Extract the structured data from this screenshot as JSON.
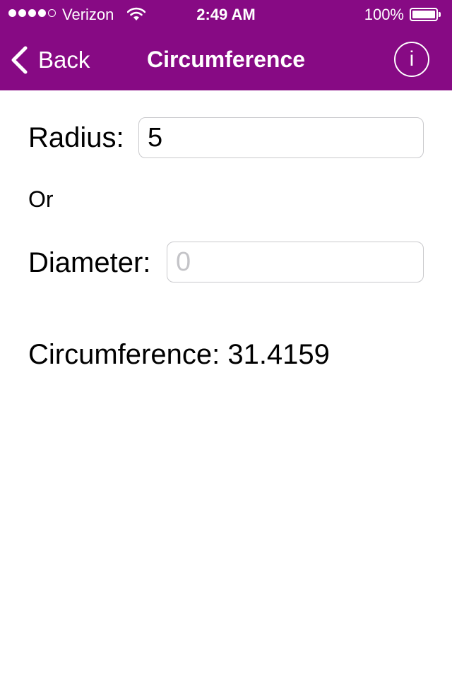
{
  "status_bar": {
    "carrier": "Verizon",
    "time": "2:49 AM",
    "battery_percent": "100%",
    "battery_level": 1.0,
    "signal_bars_filled": 4,
    "signal_bars_total": 5
  },
  "nav": {
    "back_label": "Back",
    "title": "Circumference",
    "info_glyph": "i"
  },
  "form": {
    "radius_label": "Radius:",
    "radius_value": "5",
    "or_text": "Or",
    "diameter_label": "Diameter:",
    "diameter_placeholder": "0",
    "diameter_value": ""
  },
  "result": {
    "label": "Circumference:",
    "value": "31.4159"
  },
  "colors": {
    "bar_background": "#870a84",
    "bar_text": "#ffffff"
  },
  "icons": {
    "back": "chevron-left-icon",
    "info": "info-circle-icon",
    "wifi": "wifi-icon",
    "battery": "battery-icon"
  }
}
